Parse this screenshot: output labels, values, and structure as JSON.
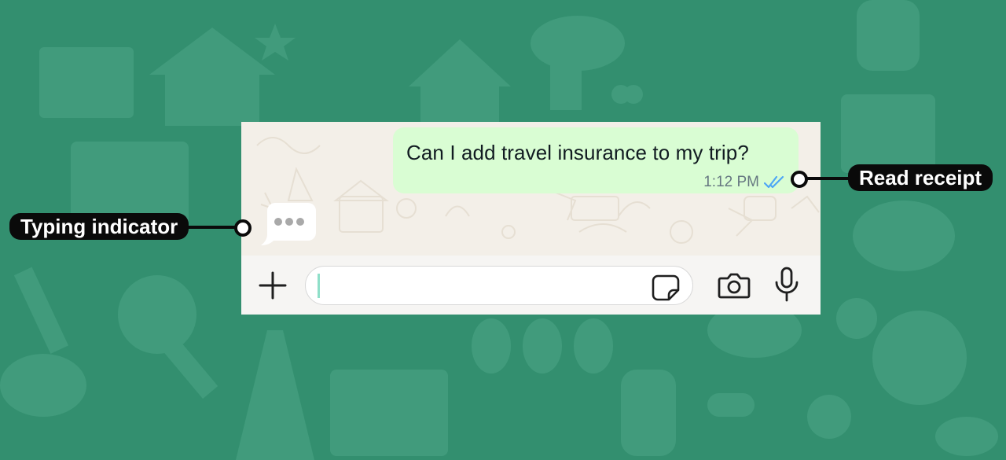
{
  "chat": {
    "outgoing_message": {
      "text": "Can I add travel insurance to my trip?",
      "time": "1:12 PM",
      "receipt_icon": "double-check-read-icon",
      "receipt_color": "#4ea6f5"
    },
    "typing_indicator_icon": "typing-dots-icon"
  },
  "composer": {
    "add_icon": "plus-icon",
    "message_value": "",
    "sticker_icon": "sticker-icon",
    "camera_icon": "camera-icon",
    "mic_icon": "microphone-icon"
  },
  "annotations": {
    "read_receipt_label": "Read receipt",
    "typing_indicator_label": "Typing indicator"
  },
  "colors": {
    "background_green": "#338f6f",
    "outgoing_bubble": "#d9fdd3",
    "chat_wallpaper": "#f3efe8",
    "callout": "#0a0a0a"
  }
}
